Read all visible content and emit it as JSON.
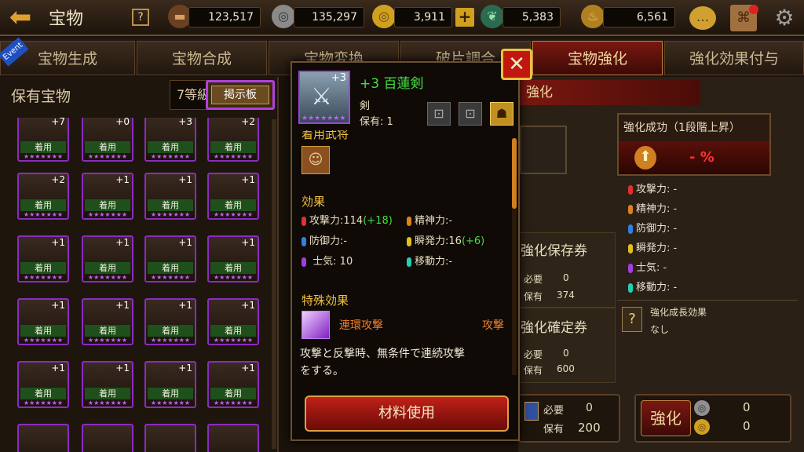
{
  "header": {
    "title": "宝物",
    "help": "?",
    "resources": [
      {
        "icon": "book-icon",
        "value": "123,517"
      },
      {
        "icon": "silver-coin-icon",
        "value": "135,297"
      },
      {
        "icon": "gold-coin-icon",
        "value": "3,911"
      },
      {
        "icon": "jade-dragon-icon",
        "value": "5,383"
      },
      {
        "icon": "lamp-icon",
        "value": "6,561"
      }
    ],
    "plus": "+"
  },
  "tabs": [
    "宝物生成",
    "宝物合成",
    "宝物変換",
    "破片調合",
    "宝物強化",
    "強化効果付与"
  ],
  "event_badge": "Event",
  "left": {
    "title": "保有宝物",
    "filter": "7等級",
    "board_button": "掲示板",
    "equip_label": "着用",
    "plus_values": [
      "+7",
      "+0",
      "+3",
      "+2",
      "+2",
      "+1",
      "+1",
      "+1",
      "+1",
      "+1",
      "+1",
      "+1",
      "+1",
      "+1",
      "+1",
      "+1",
      "+1",
      "+1",
      "+1",
      "+1"
    ]
  },
  "popup": {
    "level": "+3",
    "name": "+3 百蓮剣",
    "type": "剣",
    "owned": "保有: 1",
    "equip_heading": "着用武将",
    "effects_heading": "効果",
    "stats": [
      {
        "label": "攻撃力:",
        "value": "114",
        "bonus": "(+18)",
        "color": "#e03030"
      },
      {
        "label": "精神力:",
        "value": "-",
        "bonus": "",
        "color": "#e08020"
      },
      {
        "label": "防御力:",
        "value": "-",
        "bonus": "",
        "color": "#3080e0"
      },
      {
        "label": "瞬発力:",
        "value": "16",
        "bonus": "(+6)",
        "color": "#e0c020"
      },
      {
        "label": "士気:",
        "value": "10",
        "bonus": "",
        "color": "#a040e0"
      },
      {
        "label": "移動力:",
        "value": "-",
        "bonus": "",
        "color": "#20d0b0"
      }
    ],
    "special_heading": "特殊効果",
    "special_name": "連環攻撃",
    "special_type": "攻撃",
    "description_line1": "攻撃と反撃時、無条件で連続攻撃",
    "description_line2": "をする。",
    "material_button": "材料使用"
  },
  "behind": {
    "bg_text": "攻撃力: ",
    "tr_text": "強化成長効果",
    "minus_pct": "- %"
  },
  "right": {
    "strengthen_header": "強化",
    "success_title": "強化成功（1段階上昇）",
    "success_value": "- %",
    "stats": [
      {
        "label": "攻撃力:",
        "value": "-",
        "color": "#e03030"
      },
      {
        "label": "精神力:",
        "value": "-",
        "color": "#e08020"
      },
      {
        "label": "防御力:",
        "value": "-",
        "color": "#3080e0"
      },
      {
        "label": "瞬発力:",
        "value": "-",
        "color": "#e0c020"
      },
      {
        "label": "士気:",
        "value": "-",
        "color": "#a040e0"
      },
      {
        "label": "移動力:",
        "value": "-",
        "color": "#20d0b0"
      }
    ],
    "growth_title": "強化成長効果",
    "growth_value": "なし",
    "save_ticket": {
      "title": "強化保存券",
      "need_label": "必要",
      "need": "0",
      "have_label": "保有",
      "have": "374"
    },
    "confirm_ticket": {
      "title": "強化確定券",
      "need_label": "必要",
      "need": "0",
      "have_label": "保有",
      "have": "600"
    },
    "cost": {
      "need_label": "必要",
      "need": "0",
      "have_label": "保有",
      "have": "200"
    },
    "strengthen_button": "強化",
    "coin1": "0",
    "coin2": "0"
  }
}
